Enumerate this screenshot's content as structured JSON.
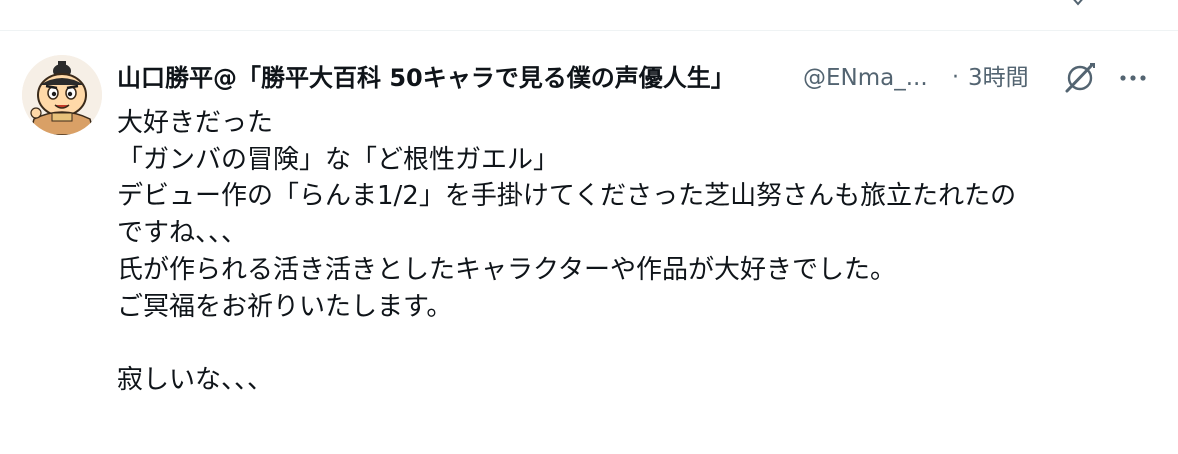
{
  "tweet": {
    "display_name": "山口勝平@「勝平大百科 50キャラで見る僕の声優人生」",
    "handle": "@ENma_...",
    "separator": "·",
    "timestamp": "3時間",
    "body_lines": [
      "大好きだった",
      "「ガンバの冒険」な「ど根性ガエル」",
      "デビュー作の「らんま1/2」を手掛けてくださった芝山努さんも旅立たれたの",
      "ですね、、、",
      "氏が作られる活き活きとしたキャラクターや作品が大好きでした。",
      "ご冥福をお祈りいたします。",
      "",
      "寂しいな、、、"
    ]
  },
  "icons": {
    "avatar": "cartoon-character-avatar",
    "grok": "grok-slash-circle-icon",
    "more": "more-horizontal-icon",
    "top_partial": "top-partial-icon"
  },
  "colors": {
    "text_primary": "#0f1419",
    "text_secondary": "#536471",
    "divider": "#eff3f4"
  }
}
